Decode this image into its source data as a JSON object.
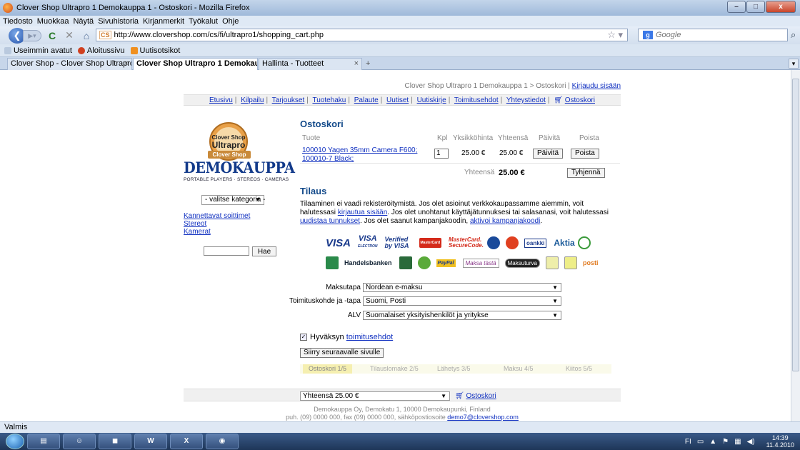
{
  "window": {
    "title": "Clover Shop Ultrapro 1 Demokauppa 1 - Ostoskori - Mozilla Firefox",
    "min": "–",
    "max": "□",
    "close": "x"
  },
  "menu": [
    "Tiedosto",
    "Muokkaa",
    "Näytä",
    "Sivuhistoria",
    "Kirjanmerkit",
    "Työkalut",
    "Ohje"
  ],
  "nav": {
    "url": "http://www.clovershop.com/cs/fi/ultrapro1/shopping_cart.php",
    "favicon": "CS",
    "search_placeholder": "Google",
    "google_badge": "g"
  },
  "bookmarks": [
    "Useimmin avatut",
    "Aloitussivu",
    "Uutisotsikot"
  ],
  "tabs": [
    {
      "label": "Clover Shop - Clover Shop Ultrapro ..."
    },
    {
      "label": "Clover Shop Ultrapro 1 Demokau..."
    },
    {
      "label": "Hallinta - Tuotteet"
    }
  ],
  "page": {
    "breadcrumb": "Clover Shop Ultrapro 1 Demokauppa 1 > Ostoskori",
    "login": "Kirjaudu sisään",
    "topnav": [
      "Etusivu",
      "Kilpailu",
      "Tarjoukset",
      "Tuotehaku",
      "Palaute",
      "Uutiset",
      "Uutiskirje",
      "Toimitusehdot",
      "Yhteystiedot"
    ],
    "topnav_cart": "Ostoskori",
    "logo": {
      "top": "Clover Shop",
      "name": "Ultrapro",
      "ribbon": "Clover Shop",
      "main": "DEMOKAUPPA",
      "sub": "PORTABLE PLAYERS · STEREOS · CAMERAS"
    },
    "category_select": "- valitse kategoria -",
    "categories": [
      "Kannettavat soittimet",
      "Stereot",
      "Kamerat"
    ],
    "side_search_button": "Hae",
    "cart": {
      "title": "Ostoskori",
      "headers": {
        "product": "Tuote",
        "qty": "Kpl",
        "unit": "Yksikköhinta",
        "total": "Yhteensä",
        "update": "Päivitä",
        "remove": "Poista"
      },
      "item": {
        "name": "100010 Yagen 35mm Camera F600; 100010-7 Black;",
        "qty": "1",
        "unit": "25.00 €",
        "total": "25.00 €"
      },
      "update_button": "Päivitä",
      "remove_button": "Poista",
      "sum_label": "Yhteensä",
      "sum_value": "25.00 €",
      "empty_button": "Tyhjennä"
    },
    "order": {
      "title": "Tilaus",
      "p1": "Tilaaminen ei vaadi rekisteröitymistä. Jos olet asioinut verkkokaupassamme aiemmin, voit halutessasi ",
      "login_link": "kirjautua sisään",
      "p2": ". Jos olet unohtanut käyttäjätunnuksesi tai salasanasi, voit halutessasi ",
      "renew_link": "uudistaa tunnukset",
      "p3": ". Jos olet saanut kampanjakoodin, ",
      "campaign_link": "aktivoi kampanjakoodi",
      "p4": "."
    },
    "payment_logos": {
      "visa": "VISA",
      "visa_electron": "VISA",
      "electron": "ELECTRON",
      "verified": "Verified by VISA",
      "mastercard": "MasterCard",
      "mc_secure": "MasterCard. SecureCode.",
      "sampo": "oankki",
      "aktia": "Aktia",
      "handelsbanken": "Handelsbanken",
      "paypal": "PayPal",
      "maksa": "Maksa tästä",
      "maksuturva": "Maksuturva",
      "posti": "posti"
    },
    "form": {
      "payment_label": "Maksutapa",
      "payment_value": "Nordean e-maksu",
      "delivery_label": "Toimituskohde ja -tapa",
      "delivery_value": "Suomi, Posti",
      "vat_label": "ALV",
      "vat_value": "Suomalaiset yksityishenkilöt ja yritykse"
    },
    "accept_text": "Hyväksyn",
    "accept_link": "toimitusehdot",
    "next_button": "Siirry seuraavalle sivulle",
    "steps": [
      "Ostoskori 1/5",
      "Tilauslomake 2/5",
      "Lähetys 3/5",
      "Maksu 4/5",
      "Kiitos 5/5"
    ],
    "footer": {
      "total_select": "Yhteensä 25.00 €",
      "cart_link": "Ostoskori",
      "address": "Demokauppa Oy, Demokatu 1, 10000 Demokaupunki, Finland",
      "contact": "puh. (09) 0000 000, fax (09) 0000 000, sähköpostiosoite ",
      "email": "demo7@clovershop.com"
    }
  },
  "status": "Valmis",
  "taskbar": {
    "lang": "FI",
    "time": "14:39",
    "date": "11.4.2010"
  }
}
